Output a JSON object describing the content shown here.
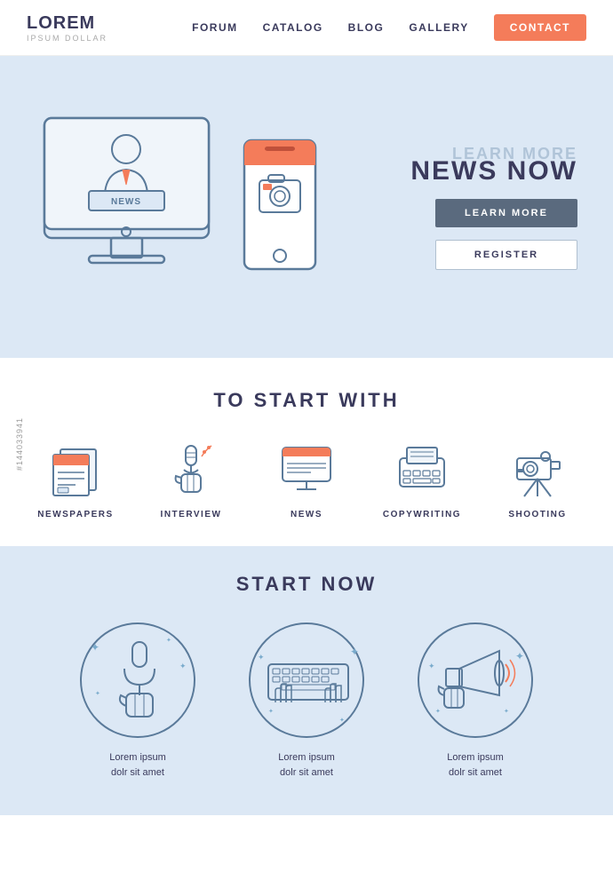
{
  "header": {
    "logo_title": "LOREM",
    "logo_sub": "IPSUM DOLLAR",
    "nav": {
      "forum": "FORUM",
      "catalog": "CATALOG",
      "blog": "BLOG",
      "gallery": "GALLERY",
      "contact": "CONTACT"
    }
  },
  "hero": {
    "subtitle": "LEARN MORE",
    "title": "NEWS NOW",
    "btn_learn": "LEARN MORE",
    "btn_register": "REGISTER"
  },
  "section2": {
    "title": "TO START WITH",
    "items": [
      {
        "label": "NEWSPAPERS",
        "icon": "newspaper"
      },
      {
        "label": "INTERVIEW",
        "icon": "interview"
      },
      {
        "label": "NEWS",
        "icon": "news-monitor"
      },
      {
        "label": "COPYWRITING",
        "icon": "typewriter"
      },
      {
        "label": "SHOOTING",
        "icon": "video-camera"
      }
    ]
  },
  "section3": {
    "title": "START NOW",
    "items": [
      {
        "label": "Lorem ipsum\ndolr sit amet",
        "icon": "microphone"
      },
      {
        "label": "Lorem ipsum\ndolr sit amet",
        "icon": "keyboard-hands"
      },
      {
        "label": "Lorem ipsum\ndolr sit amet",
        "icon": "megaphone"
      }
    ]
  },
  "watermark": "#144033941"
}
